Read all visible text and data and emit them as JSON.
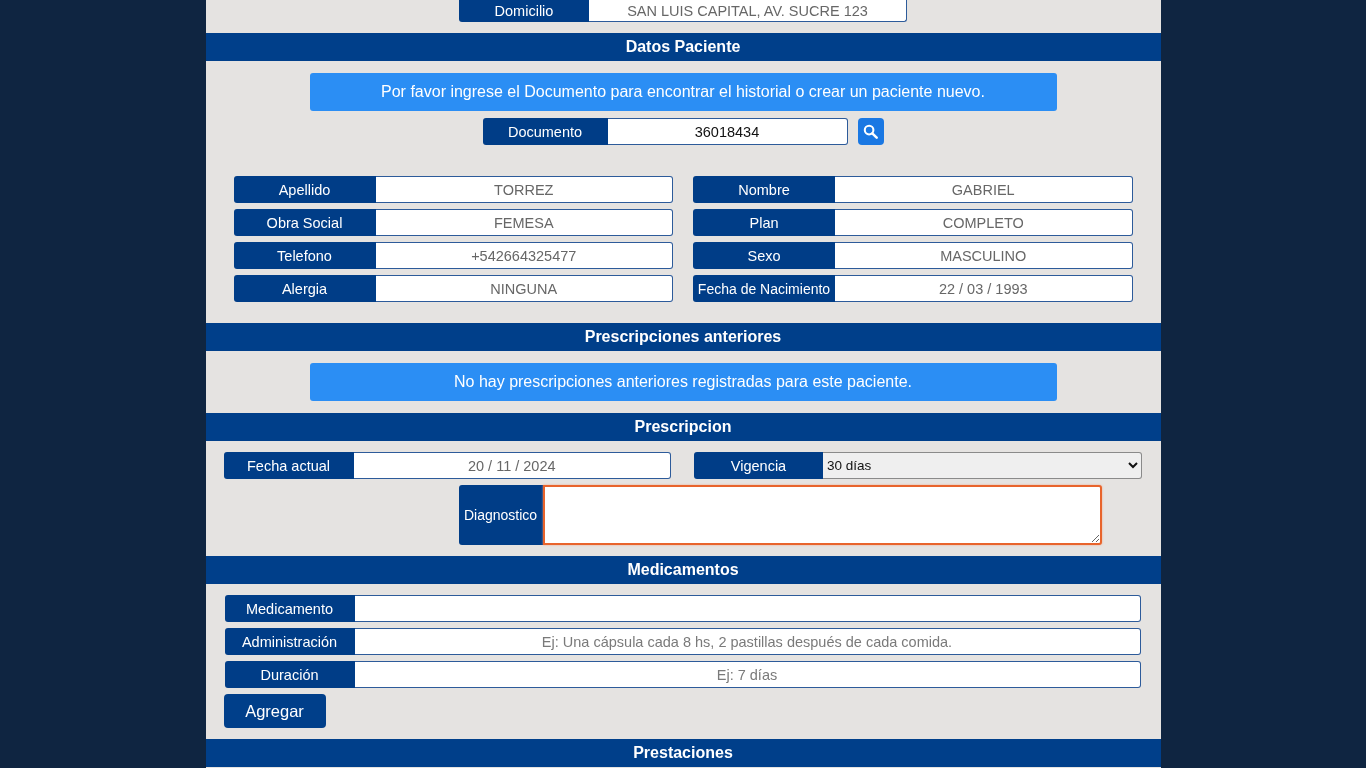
{
  "domicilio": {
    "label": "Domicilio",
    "value": "SAN LUIS CAPITAL, AV. SUCRE 123",
    "disabled": true
  },
  "datos_paciente": {
    "title": "Datos Paciente",
    "notice": "Por favor ingrese el Documento para encontrar el historial o crear un paciente nuevo.",
    "documento": {
      "label": "Documento",
      "value": "36018434",
      "disabled": false
    },
    "fields": [
      {
        "label": "Apellido",
        "value": "TORREZ",
        "disabled": true
      },
      {
        "label": "Nombre",
        "value": "GABRIEL",
        "disabled": true
      },
      {
        "label": "Obra Social",
        "value": "FEMESA",
        "disabled": true
      },
      {
        "label": "Plan",
        "value": "COMPLETO",
        "disabled": true
      },
      {
        "label": "Telefono",
        "value": "+542664325477",
        "disabled": true
      },
      {
        "label": "Sexo",
        "value": "MASCULINO",
        "disabled": true
      },
      {
        "label": "Alergia",
        "value": "NINGUNA",
        "disabled": true
      },
      {
        "label": "Fecha de Nacimiento",
        "value": "22 / 03 / 1993",
        "disabled": true
      }
    ]
  },
  "prescripciones_anteriores": {
    "title": "Prescripciones anteriores",
    "notice": "No hay prescripciones anteriores registradas para este paciente."
  },
  "prescripcion": {
    "title": "Prescripcion",
    "fecha_actual": {
      "label": "Fecha actual",
      "value": "20 / 11 / 2024",
      "disabled": true
    },
    "vigencia": {
      "label": "Vigencia",
      "value": "30 días"
    },
    "diagnostico": {
      "label": "Diagnostico",
      "focused": true
    }
  },
  "medicamentos": {
    "title": "Medicamentos",
    "fields": [
      {
        "label": "Medicamento"
      },
      {
        "label": "Administración",
        "placeholder": "Ej: Una cápsula cada 8 hs, 2 pastillas después de cada comida."
      },
      {
        "label": "Duración",
        "placeholder": "Ej: 7 días"
      }
    ],
    "add_button": "Agregar"
  },
  "prestaciones": {
    "title": "Prestaciones"
  }
}
